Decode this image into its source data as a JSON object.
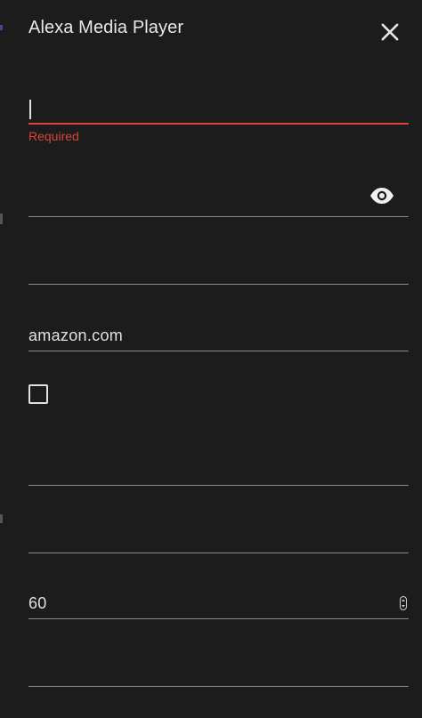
{
  "dialog": {
    "title": "Alexa Media Player",
    "close_icon": "close-icon"
  },
  "fields": {
    "username": {
      "value": "",
      "error": "Required"
    },
    "password": {
      "value": "",
      "visibility_icon": "eye-icon"
    },
    "field3": {
      "value": ""
    },
    "url": {
      "value": "amazon.com"
    },
    "checkbox": {
      "checked": false
    },
    "field6": {
      "value": ""
    },
    "field7": {
      "value": ""
    },
    "scan_interval": {
      "value": "60",
      "spinner_icon": "spinner-arrows-icon"
    },
    "field9": {
      "value": ""
    }
  },
  "colors": {
    "background": "#1c1c1c",
    "error": "#db4437",
    "text": "#e1e1e1",
    "divider": "#8a8a8a"
  }
}
